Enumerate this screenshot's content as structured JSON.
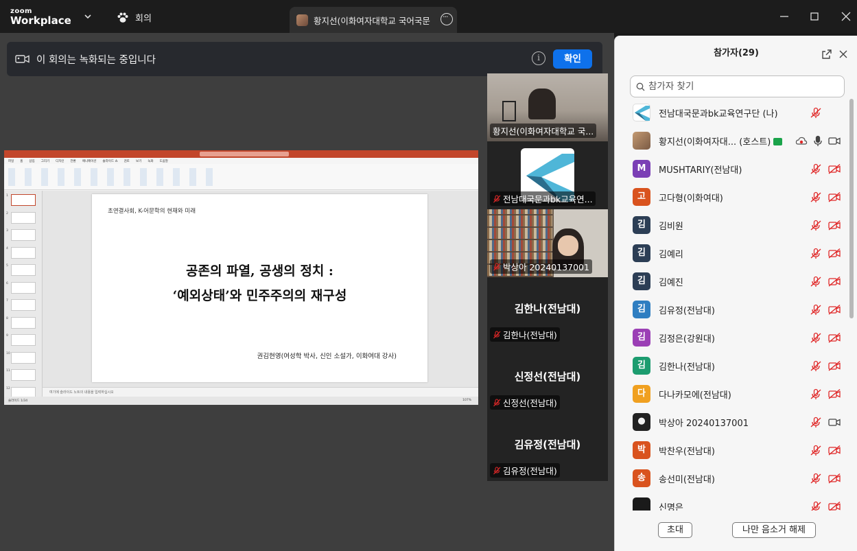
{
  "app": {
    "logo_top": "zoom",
    "logo_bottom": "Workplace"
  },
  "topbar": {
    "meeting_label": "회의",
    "active_tab_title": "황지선(이화여자대학교 국어국문"
  },
  "banner": {
    "text": "이 회의는 녹화되는 중입니다",
    "confirm_label": "확인",
    "info_glyph": "i"
  },
  "share": {
    "ppt_tabs": [
      "파일",
      "홈",
      "삽입",
      "그리기",
      "디자인",
      "전환",
      "애니메이션",
      "슬라이드 쇼",
      "검토",
      "보기",
      "녹화",
      "도움말"
    ],
    "slide_numbers": [
      "1",
      "2",
      "3",
      "4",
      "5",
      "6",
      "7",
      "8",
      "9",
      "10",
      "11",
      "12"
    ],
    "slide": {
      "header": "초연결사회, K-어문학의 현재와 미래",
      "title_line1": "공존의 파열, 공생의 정치 :",
      "title_line2": "‘예외상태’와 민주주의의 재구성",
      "author": "권김현영(여성학 박사, 신인 소설가, 이화여대 강사)"
    },
    "notes_placeholder": "여기에 슬라이드 노트의 내용을 입력하십시오",
    "status_left": "슬라이드 1/34",
    "status_zoom": "107%"
  },
  "video_tiles": [
    {
      "name": "황지선(이화여자대학교 국...",
      "big": "",
      "type": "video-person",
      "muted": false
    },
    {
      "name": "전남대국문과bk교육연...",
      "big": "",
      "type": "logo",
      "muted": true
    },
    {
      "name": "박상아 20240137001",
      "big": "",
      "type": "video-room",
      "muted": true
    },
    {
      "name": "김한나(전남대)",
      "big": "김한나(전남대)",
      "type": "text",
      "muted": true
    },
    {
      "name": "신정선(전남대)",
      "big": "신정선(전남대)",
      "type": "text",
      "muted": true
    },
    {
      "name": "김유정(전남대)",
      "big": "김유정(전남대)",
      "type": "text",
      "muted": true
    }
  ],
  "participants_panel": {
    "title": "참가자(29)",
    "search_placeholder": "참가자 찾기",
    "host_label": "(호스트)",
    "invite_label": "초대",
    "unmute_label": "나만 음소거 해제",
    "colors": {
      "muted_red": "#e02828",
      "accent_blue": "#0e71eb"
    },
    "participants": [
      {
        "name": "전남대국문과bk교육연구단 (나)",
        "avatar": "",
        "color": "#ffffff",
        "style": "logo",
        "video": "none"
      },
      {
        "name": "황지선(이화여자대...",
        "avatar": "",
        "color": "#a07a5a",
        "style": "photo",
        "video": "on",
        "host": true
      },
      {
        "name": "MUSHTARIY(전남대)",
        "avatar": "M",
        "color": "#7b3fb5",
        "style": "letter",
        "video": "off"
      },
      {
        "name": "고다형(이화여대)",
        "avatar": "고",
        "color": "#d9531e",
        "style": "letter",
        "video": "off"
      },
      {
        "name": "김비원",
        "avatar": "김",
        "color": "#2c3e55",
        "style": "letter",
        "video": "off"
      },
      {
        "name": "김예리",
        "avatar": "김",
        "color": "#2c3e55",
        "style": "letter",
        "video": "off"
      },
      {
        "name": "김예진",
        "avatar": "김",
        "color": "#2c3e55",
        "style": "letter",
        "video": "off"
      },
      {
        "name": "김유정(전남대)",
        "avatar": "김",
        "color": "#2f7ec1",
        "style": "letter",
        "video": "off"
      },
      {
        "name": "김정은(강원대)",
        "avatar": "김",
        "color": "#9b3fb5",
        "style": "letter",
        "video": "off"
      },
      {
        "name": "김한나(전남대)",
        "avatar": "김",
        "color": "#1c9c6f",
        "style": "letter",
        "video": "off"
      },
      {
        "name": "다나카모에(전남대)",
        "avatar": "다",
        "color": "#f0a020",
        "style": "letter",
        "video": "off"
      },
      {
        "name": "박상아 20240137001",
        "avatar": "",
        "color": "#333333",
        "style": "photo-dark",
        "video": "on"
      },
      {
        "name": "박찬우(전남대)",
        "avatar": "박",
        "color": "#d9531e",
        "style": "letter",
        "video": "off"
      },
      {
        "name": "송선미(전남대)",
        "avatar": "송",
        "color": "#d9531e",
        "style": "letter",
        "video": "off"
      },
      {
        "name": "신명은",
        "avatar": "",
        "color": "#1a1a1a",
        "style": "letter",
        "video": "off"
      }
    ]
  }
}
